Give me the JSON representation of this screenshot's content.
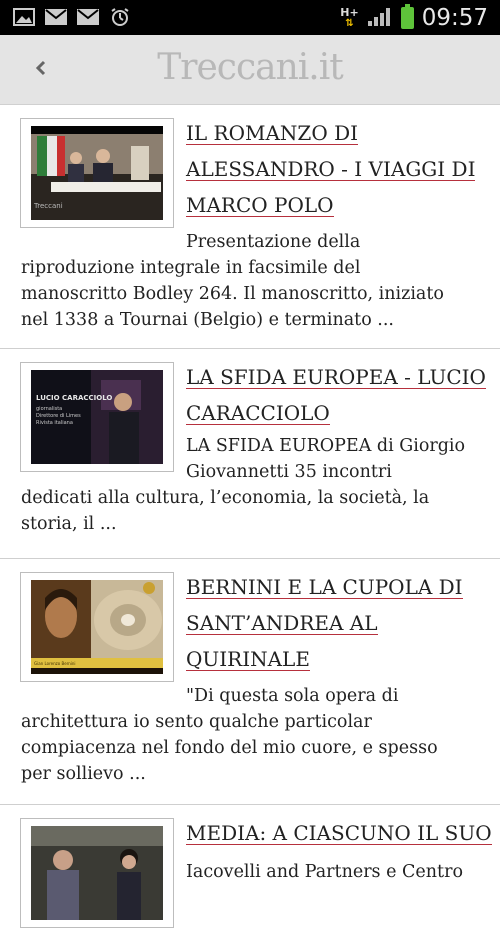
{
  "status_bar": {
    "network": "H+",
    "time": "09:57"
  },
  "header": {
    "logo": "Treccani.it",
    "back_icon": "chevron-left-icon"
  },
  "articles": [
    {
      "title_lines": [
        "IL ROMANZO DI",
        "ALESSANDRO - I VIAGGI DI",
        "MARCO POLO"
      ],
      "desc_first": "Presentazione della",
      "desc_lines": [
        "riproduzione integrale in facsimile del",
        "manoscritto Bodley 264. Il manoscritto, iniziato",
        "nel 1338 a Tournai (Belgio) e terminato ..."
      ]
    },
    {
      "title_lines": [
        "LA SFIDA EUROPEA - LUCIO",
        "CARACCIOLO"
      ],
      "desc_first": "LA SFIDA EUROPEA di Giorgio",
      "desc_first_2": "Giovannetti 35 incontri",
      "desc_lines": [
        "dedicati alla cultura, l’economia, la società, la",
        "storia, il ..."
      ]
    },
    {
      "title_lines": [
        "BERNINI E LA CUPOLA DI",
        "SANT’ANDREA AL",
        "QUIRINALE"
      ],
      "desc_first": "\"Di questa sola opera di",
      "desc_lines": [
        "architettura io sento qualche particolar",
        "compiacenza nel fondo del mio cuore, e spesso",
        "per sollievo ..."
      ]
    },
    {
      "title_lines": [
        "MEDIA: A CIASCUNO IL SUO"
      ],
      "desc_first": "Iacovelli and Partners e Centro",
      "desc_lines": []
    }
  ]
}
